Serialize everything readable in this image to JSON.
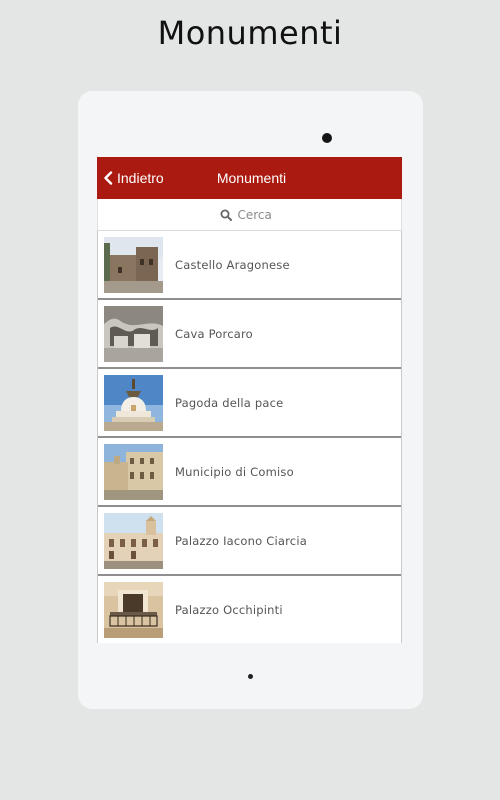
{
  "header": {
    "title": "Monumenti"
  },
  "app": {
    "navbar": {
      "back_label": "Indietro",
      "title": "Monumenti",
      "background": "#aa1a10"
    },
    "search": {
      "placeholder": "Cerca",
      "value": ""
    },
    "monuments": [
      {
        "name": "Castello Aragonese",
        "image": "castle-photo"
      },
      {
        "name": "Cava Porcaro",
        "image": "quarry-photo"
      },
      {
        "name": "Pagoda della pace",
        "image": "pagoda-photo"
      },
      {
        "name": "Municipio di Comiso",
        "image": "town-hall-photo"
      },
      {
        "name": "Palazzo Iacono Ciarcia",
        "image": "palace-photo"
      },
      {
        "name": "Palazzo Occhipinti",
        "image": "balcony-photo"
      }
    ]
  }
}
